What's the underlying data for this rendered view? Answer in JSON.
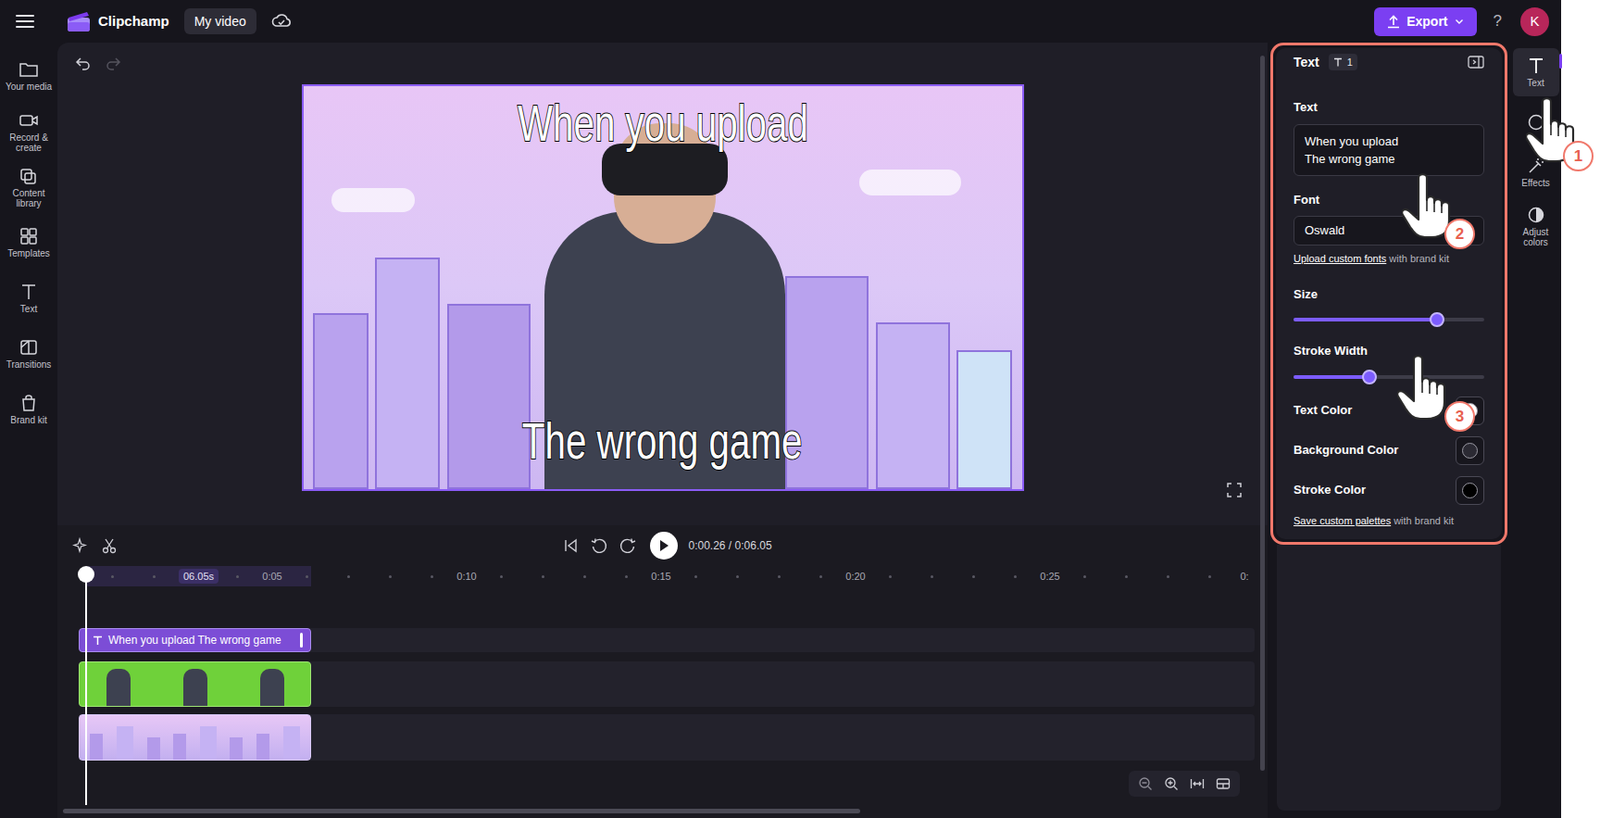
{
  "topbar": {
    "app_name": "Clipchamp",
    "project_name": "My video",
    "export": "Export",
    "help": "?",
    "avatar": "K"
  },
  "sidebar": {
    "items": [
      {
        "label": "Your media",
        "selected": false
      },
      {
        "label": "Record & create",
        "selected": false
      },
      {
        "label": "Content library",
        "selected": false
      },
      {
        "label": "Templates",
        "selected": false
      },
      {
        "label": "Text",
        "selected": false
      },
      {
        "label": "Transitions",
        "selected": false
      },
      {
        "label": "Brand kit",
        "selected": false
      }
    ]
  },
  "preview": {
    "overlay_lines": [
      "When you upload",
      "The wrong game"
    ]
  },
  "playback": {
    "time": "0:00.26 / 0:06.05",
    "playing": false
  },
  "timeline": {
    "duration_badge": "06.05s",
    "ticks": [
      "0:05",
      "0:10",
      "0:15",
      "0:20",
      "0:25",
      "0:"
    ],
    "text_clip": "When you upload The wrong game"
  },
  "properties": {
    "title": "Text",
    "badge": "1",
    "text_label": "Text",
    "text_value": "When you upload\nThe wrong game",
    "font_label": "Font",
    "font_value": "Oswald",
    "upload_link": "Upload custom fonts",
    "upload_suffix": "with brand kit",
    "sliders": [
      {
        "label": "Size",
        "level": 0.75
      },
      {
        "label": "Stroke Width",
        "level": 0.4
      }
    ],
    "colors": [
      {
        "label": "Text Color",
        "color": "#ffffff"
      },
      {
        "label": "Background Color",
        "color": "#2b2a33"
      },
      {
        "label": "Stroke Color",
        "color": "#000000"
      }
    ],
    "palette_link": "Save custom palettes",
    "palette_suffix": "with brand kit"
  },
  "tool_rail": [
    {
      "label": "Text",
      "selected": true
    },
    {
      "label": "Effects",
      "selected": false
    },
    {
      "label": "Adjust colors",
      "selected": false
    }
  ],
  "annotations": [
    {
      "number": "1"
    },
    {
      "number": "2"
    },
    {
      "number": "3"
    }
  ]
}
